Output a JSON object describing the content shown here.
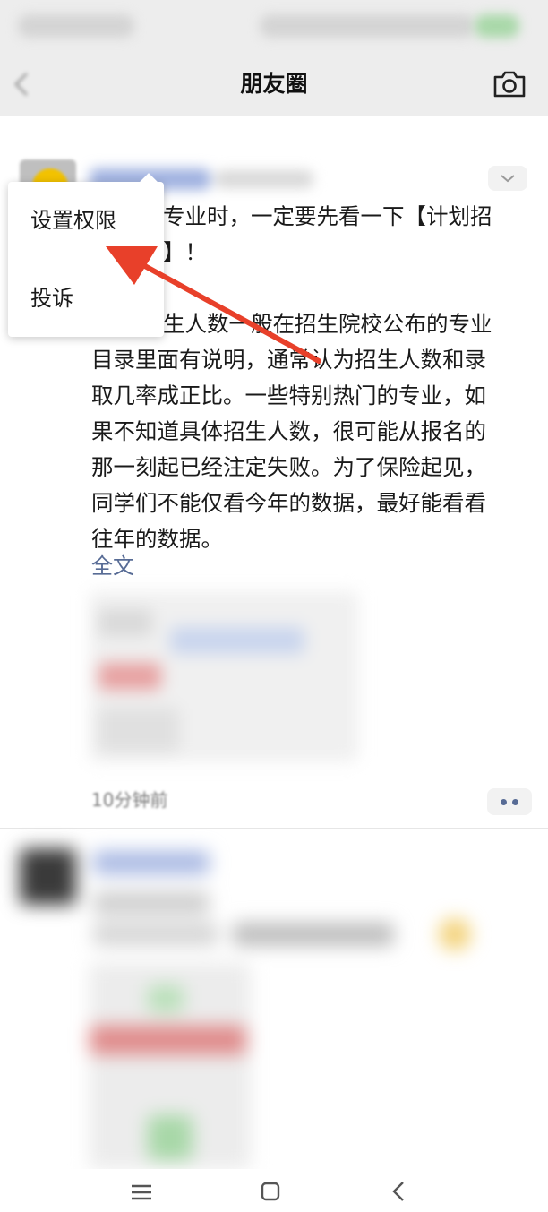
{
  "header": {
    "title": "朋友圈"
  },
  "icons": {
    "back": "back-arrow-icon",
    "camera": "camera-icon",
    "more": "chevron-down-icon",
    "comment": "more-dots-icon"
  },
  "post": {
    "text_lines": [
      "专业时，一定要先看一下【计划招",
      "】！",
      "",
      "生人数一般在招生院校公布的专业",
      "目录里面有说明，通常认为招生人数和录",
      "取几率成正比。一些特别热门的专业，如",
      "果不知道具体招生人数，很可能从报名的",
      "那一刻起已经注定失败。为了保险起见，",
      "同学们不能仅看今年的数据，最好能看看",
      "往年的数据。"
    ],
    "full_text_link": "全文",
    "time": "10分钟前"
  },
  "context_menu": {
    "items": [
      "设置权限",
      "投诉"
    ]
  },
  "colors": {
    "nav_bg": "#ededed",
    "link": "#576b95",
    "annotation_arrow": "#e8402a"
  }
}
